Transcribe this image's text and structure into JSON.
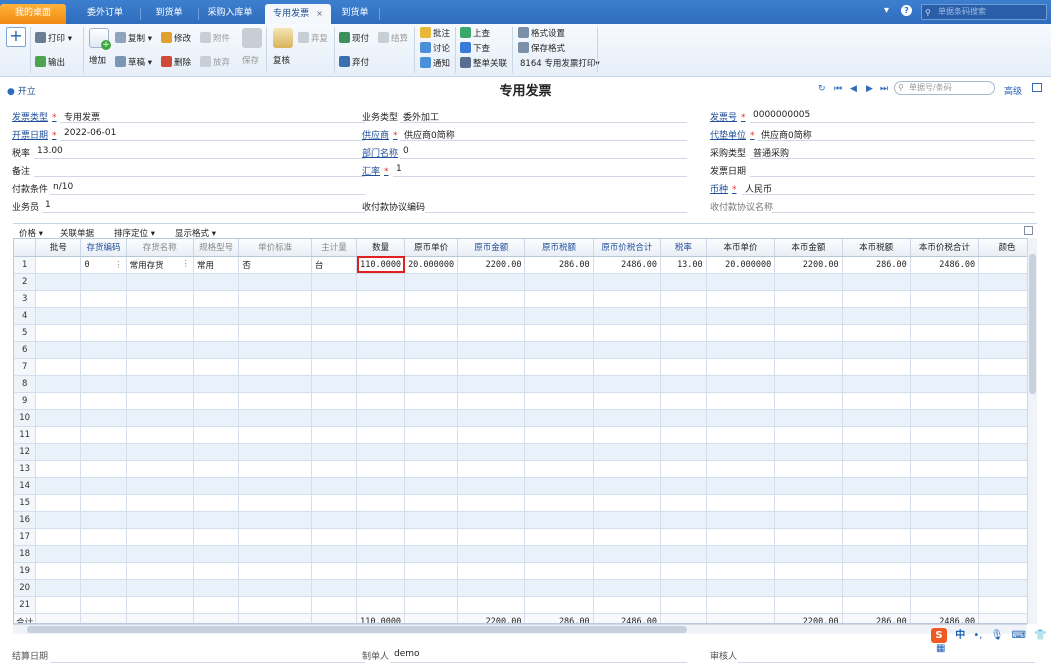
{
  "tabs": [
    {
      "label": "我的桌面"
    },
    {
      "label": "委外订单"
    },
    {
      "label": "到货单"
    },
    {
      "label": "采购入库单"
    },
    {
      "label": "专用发票",
      "close": "×"
    },
    {
      "label": "到货单"
    }
  ],
  "topbar": {
    "search_placeholder": "单据条码搜索",
    "dropdown_icon": "▾",
    "help_icon": "?",
    "gear_icon": "⚙",
    "search_icon": "⚲"
  },
  "toolbar": {
    "print": "打印",
    "export": "输出",
    "add": "增加",
    "copy": "复制",
    "draft": "草稿",
    "modify": "修改",
    "delete": "删除",
    "attachment": "附件",
    "discard": "放弃",
    "save": "保存",
    "review": "复核",
    "abandon_review": "弃复",
    "cash_pay": "现付",
    "settle": "结算",
    "abandon_pay": "弃付",
    "annotate": "批注",
    "discuss": "讨论",
    "notify": "通知",
    "prev_check": "上查",
    "next_check": "下查",
    "whole_link": "整单关联",
    "format_settings": "格式设置",
    "save_format": "保存格式",
    "print_template": "8164 专用发票打印▾"
  },
  "titlebar": {
    "opener": "开立",
    "title": "专用发票",
    "search_placeholder": "单据号/条码",
    "advanced": "高级",
    "nav_icons": [
      "↻",
      "⏮",
      "◀",
      "▶",
      "⏭"
    ]
  },
  "header": {
    "invoice_type": {
      "label": "发票类型",
      "value": "专用发票"
    },
    "business_type": {
      "label": "业务类型",
      "value": "委外加工"
    },
    "invoice_no": {
      "label": "发票号",
      "value": "0000000005"
    },
    "issue_date": {
      "label": "开票日期",
      "value": "2022-06-01"
    },
    "supplier": {
      "label": "供应商",
      "value": "供应商0简称"
    },
    "agent_unit": {
      "label": "代垫单位",
      "value": "供应商0简称"
    },
    "tax_rate": {
      "label": "税率",
      "value": "13.00"
    },
    "dept": {
      "label": "部门名称",
      "value": "0"
    },
    "purchase_type": {
      "label": "采购类型",
      "value": "普通采购"
    },
    "remark": {
      "label": "备注",
      "value": ""
    },
    "exchange_rate": {
      "label": "汇率",
      "value": "1"
    },
    "invoice_date": {
      "label": "发票日期",
      "value": ""
    },
    "payment_terms": {
      "label": "付款条件",
      "value": "n/10"
    },
    "currency": {
      "label": "币种",
      "value": "人民币"
    },
    "salesperson": {
      "label": "业务员",
      "value": "1"
    },
    "receipt_code": {
      "label": "收付款协议编码",
      "value": ""
    },
    "receipt_name": {
      "label": "收付款协议名称",
      "value": ""
    }
  },
  "gridbar": {
    "price": "价格",
    "related": "关联单据",
    "sort": "排序定位",
    "display": "显示格式"
  },
  "grid": {
    "columns": [
      "",
      "批号",
      "存货编码",
      "存货名称",
      "规格型号",
      "单价标准",
      "主计量",
      "数量",
      "原币单价",
      "原币金额",
      "原币税额",
      "原币价税合计",
      "税率",
      "本币单价",
      "本币金额",
      "本币税额",
      "本币价税合计",
      "颜色"
    ],
    "row1": [
      "1",
      "",
      "0",
      "常用存货",
      "常用",
      "否",
      "台",
      "110.0000",
      "20.000000",
      "2200.00",
      "286.00",
      "2486.00",
      "13.00",
      "20.000000",
      "2200.00",
      "286.00",
      "2486.00",
      ""
    ],
    "row_numbers": [
      "2",
      "3",
      "4",
      "5",
      "6",
      "7",
      "8",
      "9",
      "10",
      "11",
      "12",
      "13",
      "14",
      "15",
      "16",
      "17",
      "18",
      "19",
      "20",
      "21"
    ],
    "total": {
      "label": "合计",
      "qty": "110.0000",
      "amount": "2200.00",
      "tax": "286.00",
      "total": "2486.00",
      "local_amount": "2200.00",
      "local_tax": "286.00",
      "local_total": "2486.00"
    }
  },
  "footer": {
    "settle_date": "结算日期",
    "maker": "制单人",
    "maker_value": "demo",
    "auditor": "审核人"
  },
  "ime": {
    "logo": "S",
    "lang": "中",
    "items": [
      "•,",
      "🎙",
      "⌨",
      "👕",
      "▦"
    ]
  }
}
